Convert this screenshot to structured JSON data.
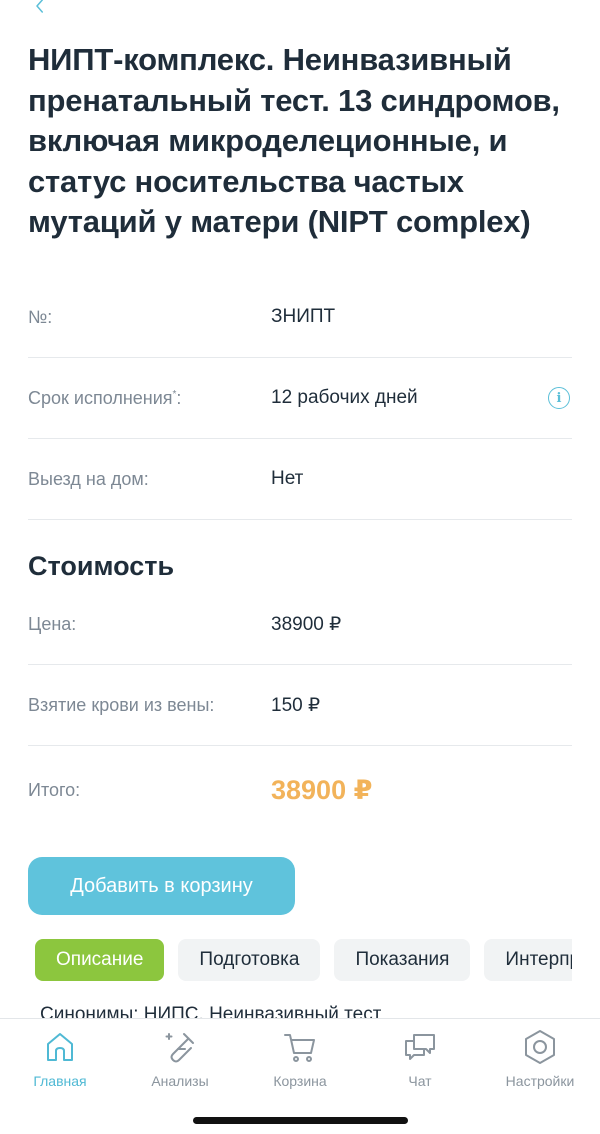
{
  "header": {
    "title": "НИПТ-комплекс. Неинвазивный пренатальный тест. 13 синдромов, включая микроделеционные, и статус носительства частых мутаций у матери (NIPT complex)"
  },
  "details": {
    "code_label": "№:",
    "code_value": "ЗНИПТ",
    "term_label": "Срок исполнения",
    "term_mark": "*",
    "term_colon": ":",
    "term_value": "12 рабочих дней",
    "info_glyph": "i",
    "home_label": "Выезд на дом:",
    "home_value": "Нет"
  },
  "cost": {
    "section_title": "Стоимость",
    "price_label": "Цена:",
    "price_value": "38900 ₽",
    "blood_label": "Взятие крови из вены:",
    "blood_value": "150 ₽",
    "total_label": "Итого:",
    "total_value": "38900 ₽"
  },
  "actions": {
    "add_to_cart": "Добавить в корзину"
  },
  "tabs": [
    {
      "label": "Описание",
      "active": true
    },
    {
      "label": "Подготовка",
      "active": false
    },
    {
      "label": "Показания",
      "active": false
    },
    {
      "label": "Интерпретация",
      "active": false
    }
  ],
  "content_peek": "Синонимы: НИПС, Неинвазивный тест",
  "tabbar": {
    "items": [
      {
        "label": "Главная",
        "icon": "home-icon",
        "active": true
      },
      {
        "label": "Анализы",
        "icon": "test-tube-icon",
        "active": false
      },
      {
        "label": "Корзина",
        "icon": "cart-icon",
        "active": false
      },
      {
        "label": "Чат",
        "icon": "chat-icon",
        "active": false
      },
      {
        "label": "Настройки",
        "icon": "settings-icon",
        "active": false
      }
    ]
  },
  "colors": {
    "accent": "#5fc3dc",
    "active_tab": "#8cc63e",
    "total_price": "#f2b35a",
    "text": "#1f2d3a",
    "muted": "#7d8894"
  }
}
